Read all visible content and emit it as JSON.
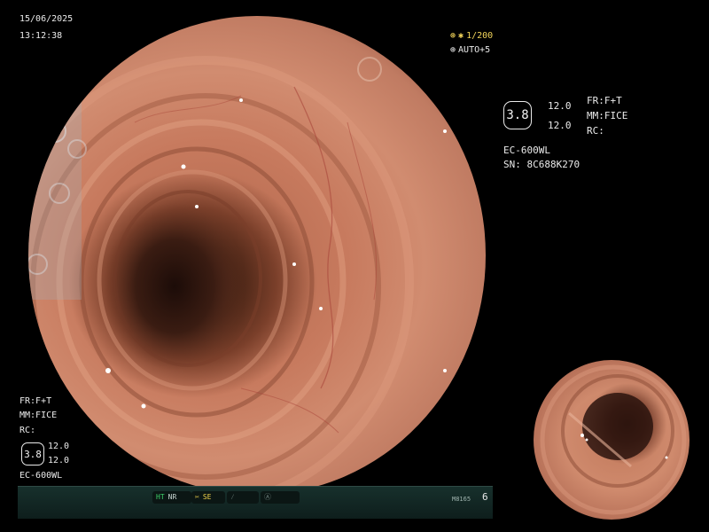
{
  "header": {
    "date": "15/06/2025",
    "time": "13:12:38"
  },
  "exposure": {
    "shutter": "1/200",
    "auto": "AUTO+5"
  },
  "right_panel": {
    "badge": "3.8",
    "val1": "12.0",
    "val2": "12.0",
    "fr": "FR:F+T",
    "mm": "MM:FICE",
    "rc": "RC:",
    "scope": "EC-600WL",
    "serial": "SN: 8C688K270"
  },
  "left_panel": {
    "fr": "FR:F+T",
    "mm": "MM:FICE",
    "rc": "RC:",
    "badge": "3.8",
    "val1": "12.0",
    "val2": "12.0",
    "scope": "EC-600WL"
  },
  "status_bar": {
    "ht": "HT",
    "nr": "NR",
    "se": "SE",
    "code": "M8165",
    "count": "6"
  },
  "icons": {
    "shutter_icon": "aperture-icon",
    "auto_icon": "auto-exposure-icon",
    "scissors_icon": "scissors-icon",
    "pen_icon": "pen-icon",
    "circle_icon": "circle-a-icon"
  },
  "colors": {
    "background": "#000000",
    "text": "#eaeaea",
    "accent_yellow": "#f2d45a",
    "status_green": "#3ed36a",
    "tissue": "#c77a5e",
    "lumen": "#2b140e"
  }
}
